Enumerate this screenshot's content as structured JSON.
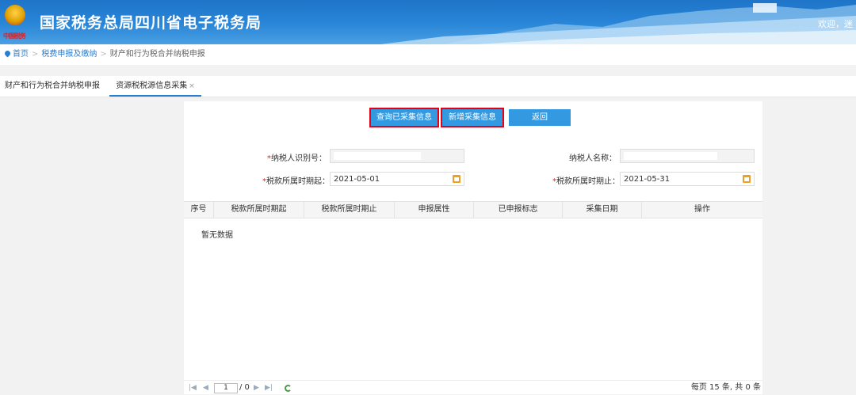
{
  "header": {
    "title": "国家税务总局四川省电子税务局",
    "emblem_text": "中国税务",
    "welcome": "欢迎，迷"
  },
  "breadcrumb": {
    "home": "首页",
    "level1": "税费申报及缴纳",
    "level2": "财产和行为税合并纳税申报",
    "separator": ">"
  },
  "tabs": [
    {
      "label": "财产和行为税合并纳税申报"
    },
    {
      "label": "资源税税源信息采集",
      "close": "×"
    }
  ],
  "buttons": {
    "query": "查询已采集信息",
    "new": "新增采集信息",
    "back": "返回"
  },
  "form": {
    "taxpayer_id_label": "纳税人识别号：",
    "taxpayer_name_label": "纳税人名称：",
    "period_start_label": "税款所属时期起：",
    "period_start_value": "2021-05-01",
    "period_end_label": "税款所属时期止：",
    "period_end_value": "2021-05-31",
    "required_mark": "*"
  },
  "table": {
    "columns": [
      "序号",
      "税款所属时期起",
      "税款所属时期止",
      "申报属性",
      "已申报标志",
      "采集日期",
      "操作"
    ],
    "empty_text": "暂无数据"
  },
  "pager": {
    "page": "1",
    "total_pages": "/ 0",
    "summary": "每页 15 条, 共 0 条"
  },
  "colors": {
    "accent": "#3399e0",
    "highlight_box": "#e60012",
    "required": "#e02020"
  }
}
